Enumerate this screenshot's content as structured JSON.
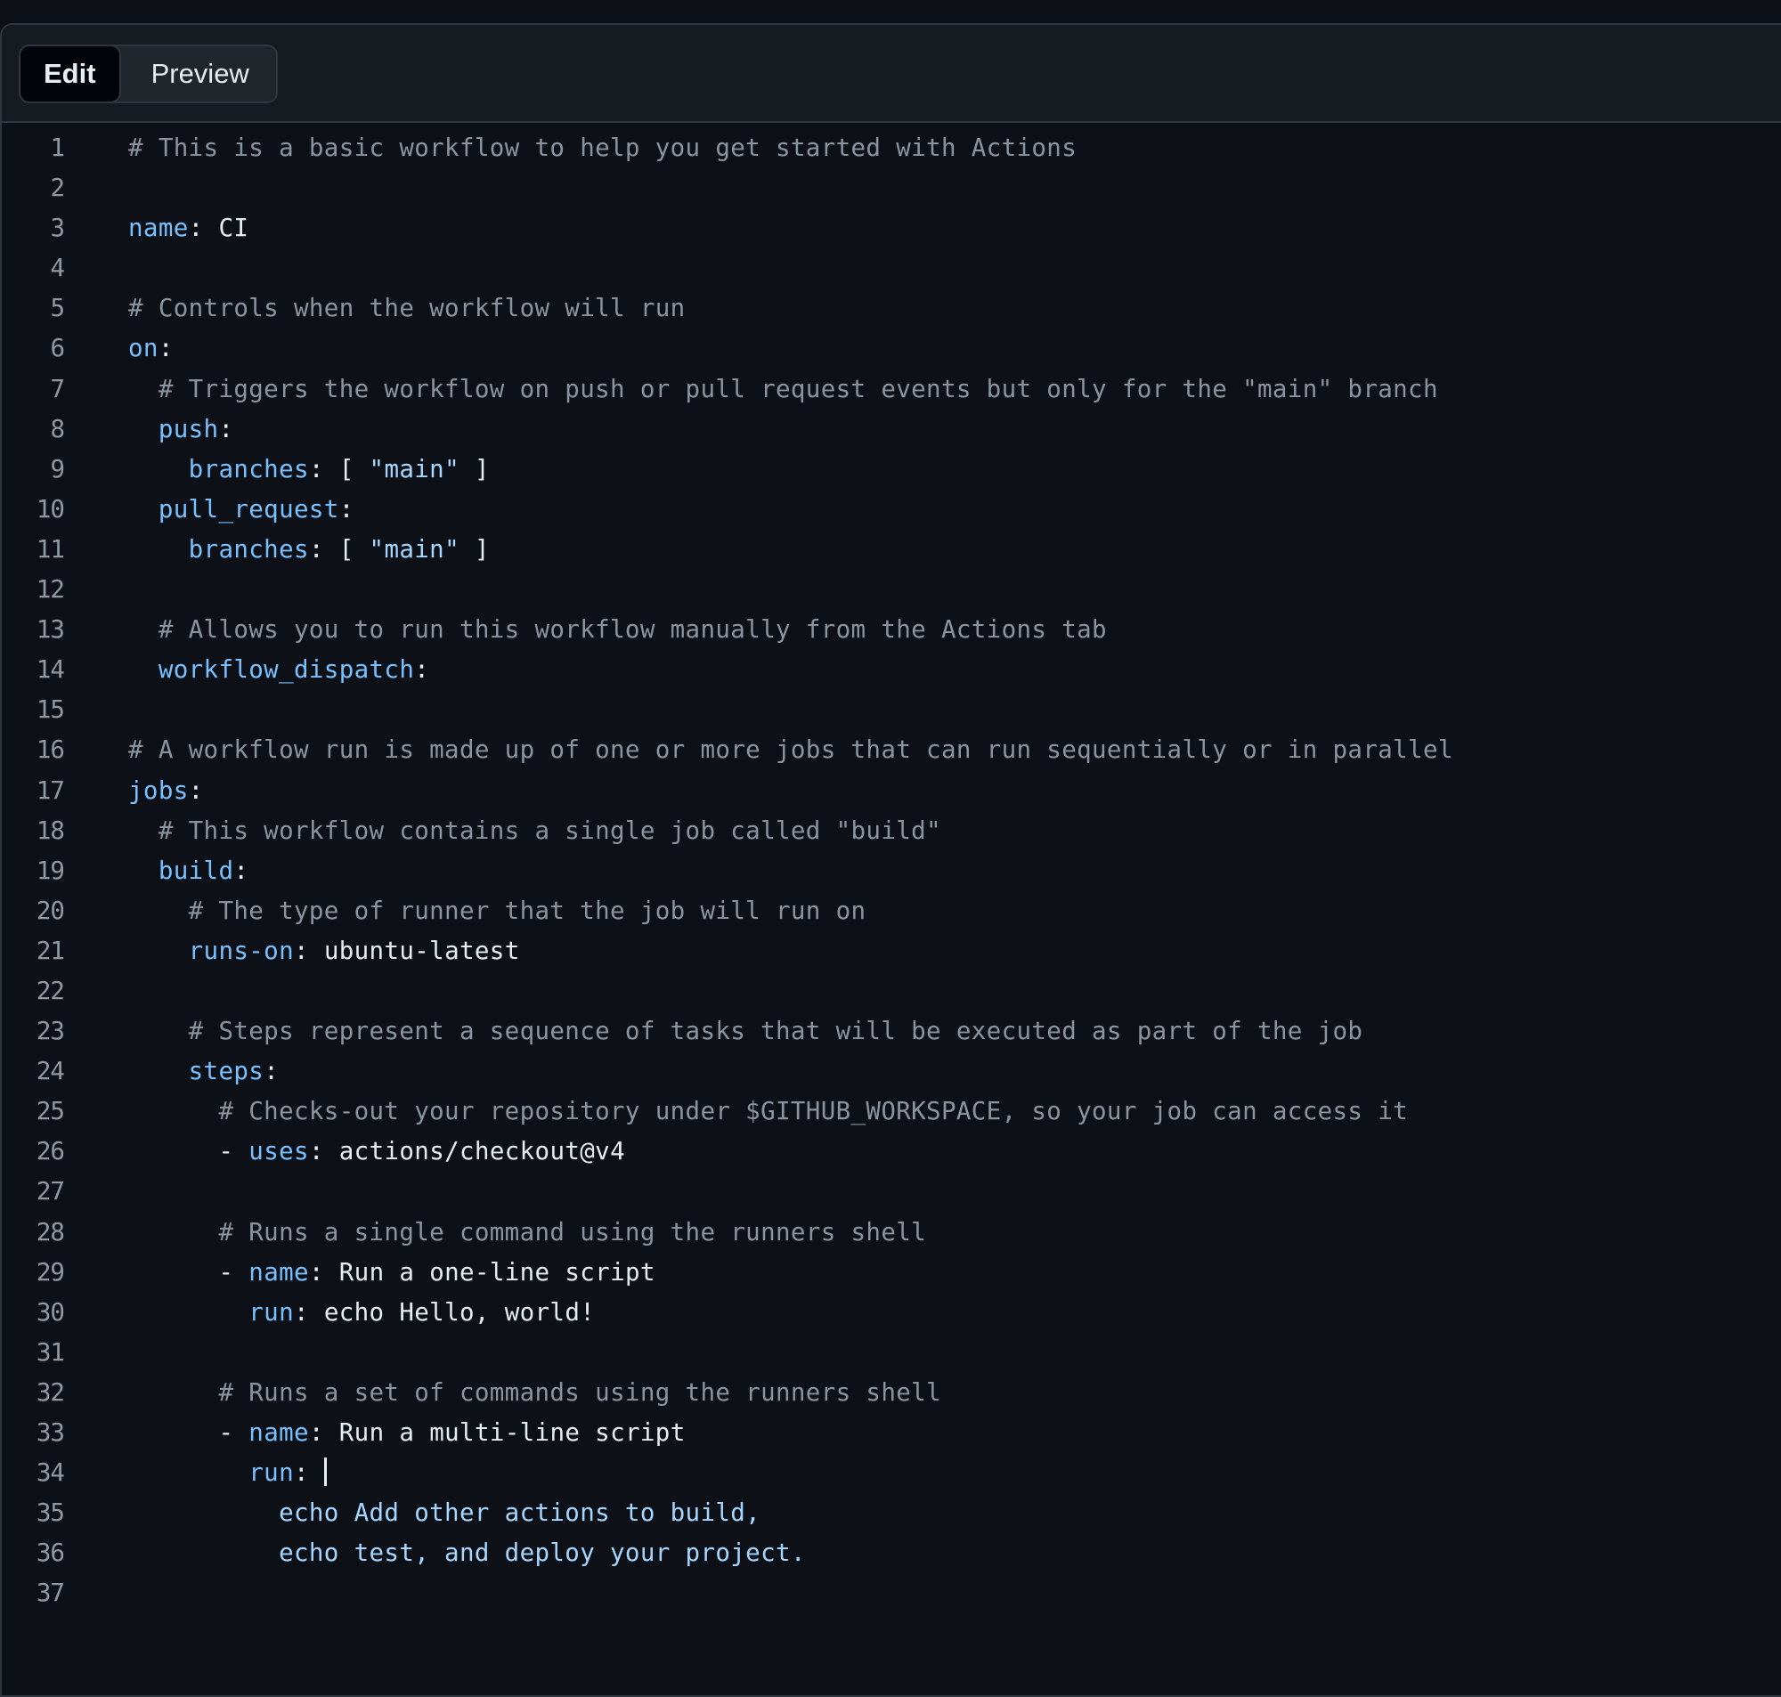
{
  "editor_tabs": {
    "edit_label": "Edit",
    "preview_label": "Preview",
    "active": "Edit"
  },
  "colors": {
    "background": "#0d1117",
    "toolbar": "#161b22",
    "border": "#30363d",
    "comment": "#8b949e",
    "key": "#79c0ff",
    "value": "#e6edf3",
    "block_string": "#a5d6ff",
    "line_number": "#9198a1"
  },
  "code_lines": [
    {
      "n": "1",
      "indent": "",
      "tokens": [
        {
          "t": "comment",
          "v": "# This is a basic workflow to help you get started with Actions"
        }
      ]
    },
    {
      "n": "2",
      "indent": "",
      "tokens": []
    },
    {
      "n": "3",
      "indent": "",
      "tokens": [
        {
          "t": "key",
          "v": "name"
        },
        {
          "t": "punct",
          "v": ": "
        },
        {
          "t": "val",
          "v": "CI"
        }
      ]
    },
    {
      "n": "4",
      "indent": "",
      "tokens": []
    },
    {
      "n": "5",
      "indent": "",
      "tokens": [
        {
          "t": "comment",
          "v": "# Controls when the workflow will run"
        }
      ]
    },
    {
      "n": "6",
      "indent": "",
      "tokens": [
        {
          "t": "key",
          "v": "on"
        },
        {
          "t": "punct",
          "v": ":"
        }
      ]
    },
    {
      "n": "7",
      "indent": "  ",
      "tokens": [
        {
          "t": "comment",
          "v": "# Triggers the workflow on push or pull request events but only for the \"main\" branch"
        }
      ]
    },
    {
      "n": "8",
      "indent": "  ",
      "tokens": [
        {
          "t": "key",
          "v": "push"
        },
        {
          "t": "punct",
          "v": ":"
        }
      ]
    },
    {
      "n": "9",
      "indent": "    ",
      "tokens": [
        {
          "t": "key",
          "v": "branches"
        },
        {
          "t": "punct",
          "v": ": [ "
        },
        {
          "t": "str",
          "v": "\"main\""
        },
        {
          "t": "punct",
          "v": " ]"
        }
      ]
    },
    {
      "n": "10",
      "indent": "  ",
      "tokens": [
        {
          "t": "key",
          "v": "pull_request"
        },
        {
          "t": "punct",
          "v": ":"
        }
      ]
    },
    {
      "n": "11",
      "indent": "    ",
      "tokens": [
        {
          "t": "key",
          "v": "branches"
        },
        {
          "t": "punct",
          "v": ": [ "
        },
        {
          "t": "str",
          "v": "\"main\""
        },
        {
          "t": "punct",
          "v": " ]"
        }
      ]
    },
    {
      "n": "12",
      "indent": "",
      "tokens": []
    },
    {
      "n": "13",
      "indent": "  ",
      "tokens": [
        {
          "t": "comment",
          "v": "# Allows you to run this workflow manually from the Actions tab"
        }
      ]
    },
    {
      "n": "14",
      "indent": "  ",
      "tokens": [
        {
          "t": "key",
          "v": "workflow_dispatch"
        },
        {
          "t": "punct",
          "v": ":"
        }
      ]
    },
    {
      "n": "15",
      "indent": "",
      "tokens": []
    },
    {
      "n": "16",
      "indent": "",
      "tokens": [
        {
          "t": "comment",
          "v": "# A workflow run is made up of one or more jobs that can run sequentially or in parallel"
        }
      ]
    },
    {
      "n": "17",
      "indent": "",
      "tokens": [
        {
          "t": "key",
          "v": "jobs"
        },
        {
          "t": "punct",
          "v": ":"
        }
      ]
    },
    {
      "n": "18",
      "indent": "  ",
      "tokens": [
        {
          "t": "comment",
          "v": "# This workflow contains a single job called \"build\""
        }
      ]
    },
    {
      "n": "19",
      "indent": "  ",
      "tokens": [
        {
          "t": "key",
          "v": "build"
        },
        {
          "t": "punct",
          "v": ":"
        }
      ]
    },
    {
      "n": "20",
      "indent": "    ",
      "tokens": [
        {
          "t": "comment",
          "v": "# The type of runner that the job will run on"
        }
      ]
    },
    {
      "n": "21",
      "indent": "    ",
      "tokens": [
        {
          "t": "key",
          "v": "runs-on"
        },
        {
          "t": "punct",
          "v": ": "
        },
        {
          "t": "val",
          "v": "ubuntu-latest"
        }
      ]
    },
    {
      "n": "22",
      "indent": "",
      "tokens": []
    },
    {
      "n": "23",
      "indent": "    ",
      "tokens": [
        {
          "t": "comment",
          "v": "# Steps represent a sequence of tasks that will be executed as part of the job"
        }
      ]
    },
    {
      "n": "24",
      "indent": "    ",
      "tokens": [
        {
          "t": "key",
          "v": "steps"
        },
        {
          "t": "punct",
          "v": ":"
        }
      ]
    },
    {
      "n": "25",
      "indent": "      ",
      "tokens": [
        {
          "t": "comment",
          "v": "# Checks-out your repository under $GITHUB_WORKSPACE, so your job can access it"
        }
      ]
    },
    {
      "n": "26",
      "indent": "      ",
      "tokens": [
        {
          "t": "punct",
          "v": "- "
        },
        {
          "t": "key",
          "v": "uses"
        },
        {
          "t": "punct",
          "v": ": "
        },
        {
          "t": "val",
          "v": "actions/checkout@v4"
        }
      ]
    },
    {
      "n": "27",
      "indent": "",
      "tokens": []
    },
    {
      "n": "28",
      "indent": "      ",
      "tokens": [
        {
          "t": "comment",
          "v": "# Runs a single command using the runners shell"
        }
      ]
    },
    {
      "n": "29",
      "indent": "      ",
      "tokens": [
        {
          "t": "punct",
          "v": "- "
        },
        {
          "t": "key",
          "v": "name"
        },
        {
          "t": "punct",
          "v": ": "
        },
        {
          "t": "val",
          "v": "Run a one-line script"
        }
      ]
    },
    {
      "n": "30",
      "indent": "        ",
      "tokens": [
        {
          "t": "key",
          "v": "run"
        },
        {
          "t": "punct",
          "v": ": "
        },
        {
          "t": "val",
          "v": "echo Hello, world!"
        }
      ]
    },
    {
      "n": "31",
      "indent": "",
      "tokens": []
    },
    {
      "n": "32",
      "indent": "      ",
      "tokens": [
        {
          "t": "comment",
          "v": "# Runs a set of commands using the runners shell"
        }
      ]
    },
    {
      "n": "33",
      "indent": "      ",
      "tokens": [
        {
          "t": "punct",
          "v": "- "
        },
        {
          "t": "key",
          "v": "name"
        },
        {
          "t": "punct",
          "v": ": "
        },
        {
          "t": "val",
          "v": "Run a multi-line script"
        }
      ]
    },
    {
      "n": "34",
      "indent": "        ",
      "tokens": [
        {
          "t": "key",
          "v": "run"
        },
        {
          "t": "punct",
          "v": ": "
        },
        {
          "t": "pipe",
          "v": "|"
        }
      ]
    },
    {
      "n": "35",
      "indent": "          ",
      "tokens": [
        {
          "t": "block",
          "v": "echo Add other actions to build,"
        }
      ]
    },
    {
      "n": "36",
      "indent": "          ",
      "tokens": [
        {
          "t": "block",
          "v": "echo test, and deploy your project."
        }
      ]
    },
    {
      "n": "37",
      "indent": "",
      "tokens": []
    }
  ]
}
